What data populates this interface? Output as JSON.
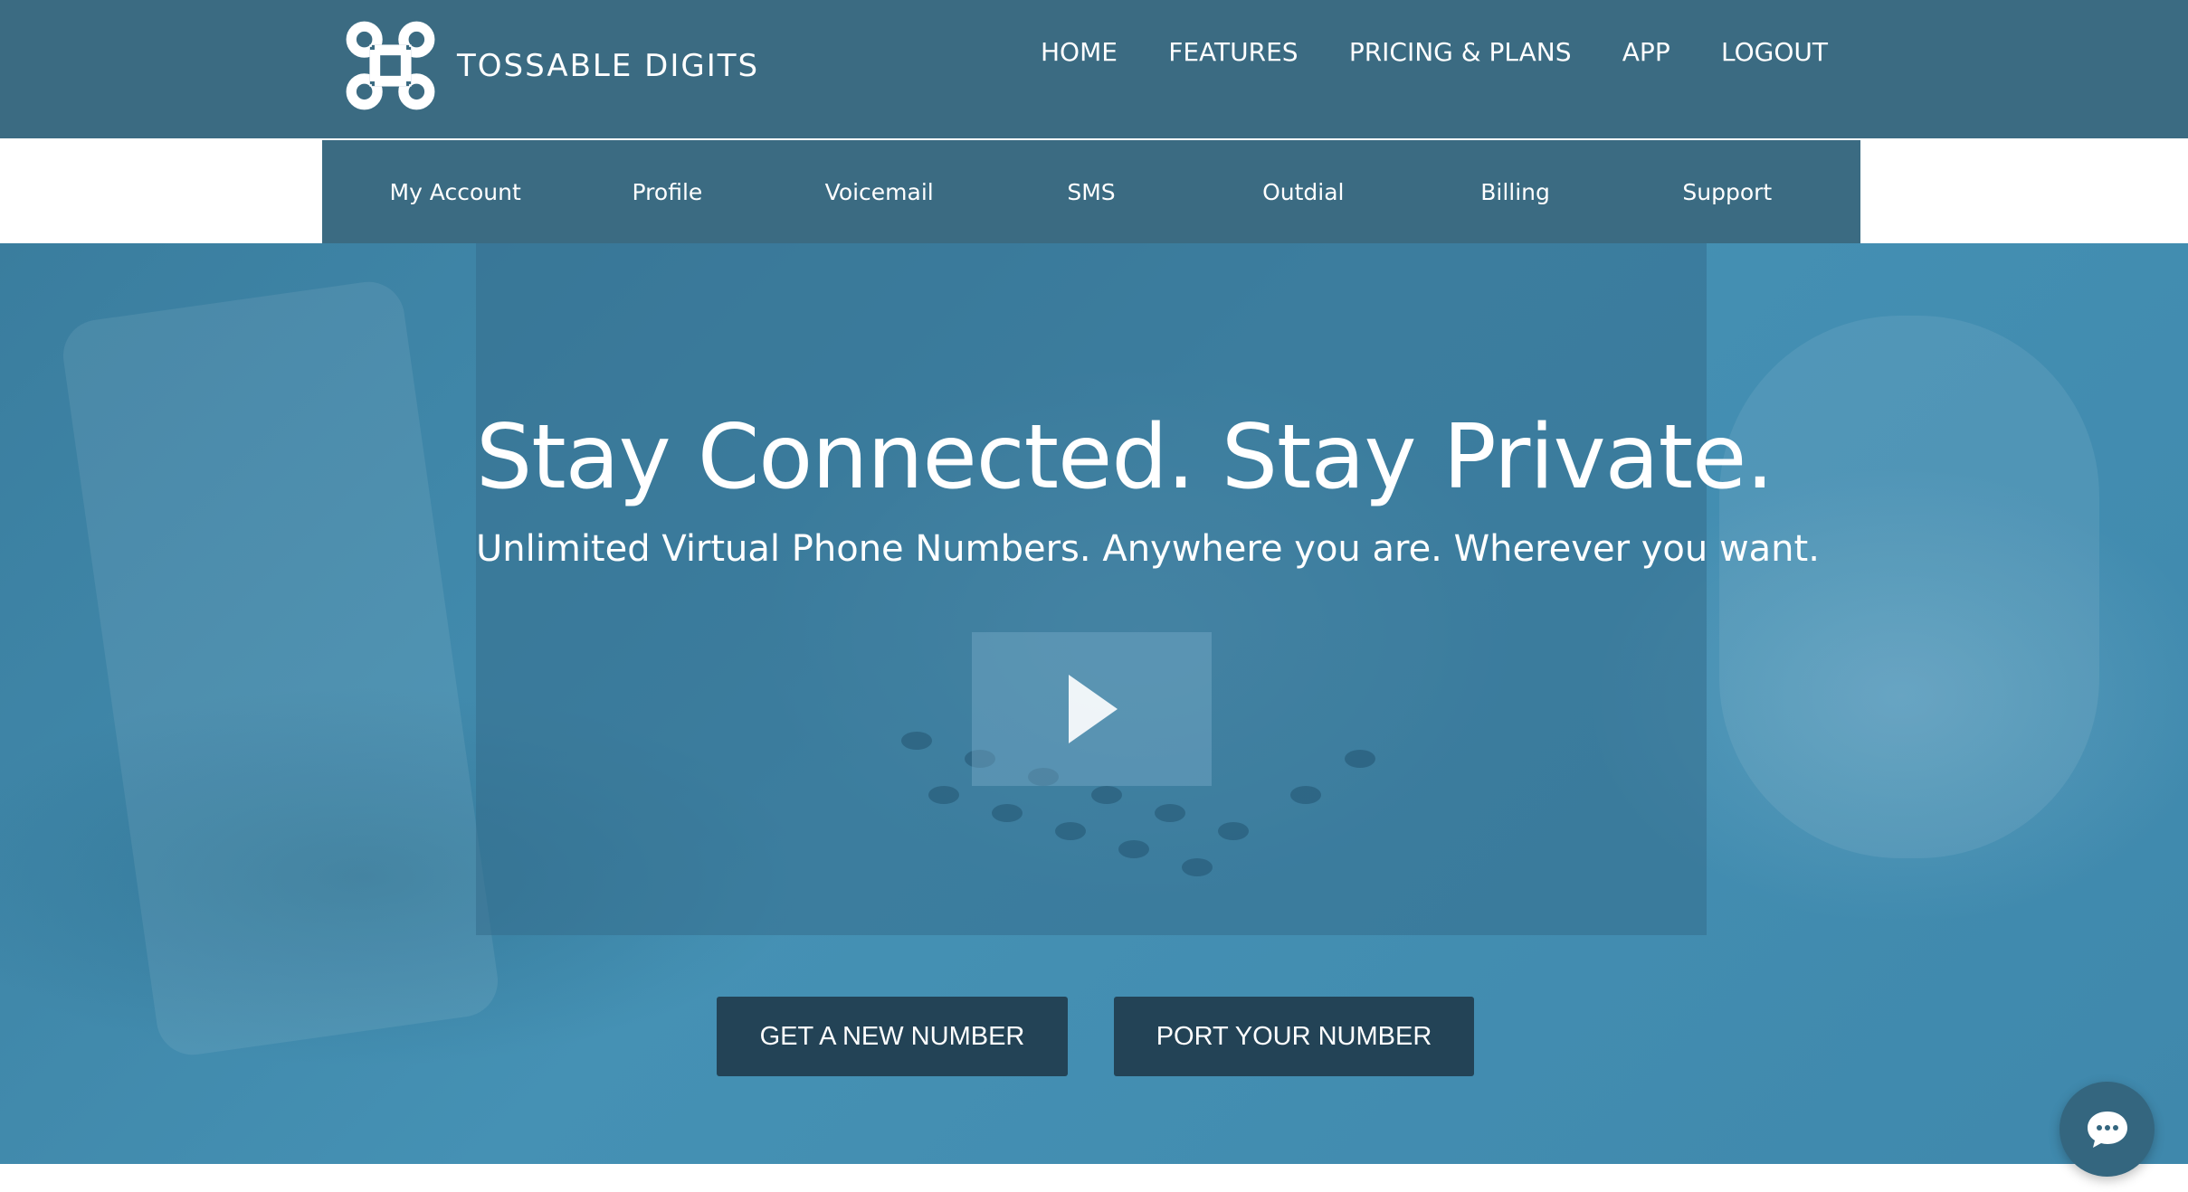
{
  "brand": {
    "name": "TOSSABLE DIGITS",
    "logo_icon": "command-key-icon"
  },
  "top_nav": {
    "items": [
      {
        "label": "HOME"
      },
      {
        "label": "FEATURES"
      },
      {
        "label": "PRICING & PLANS"
      },
      {
        "label": "APP"
      },
      {
        "label": "LOGOUT"
      }
    ]
  },
  "sub_nav": {
    "items": [
      {
        "label": "My Account"
      },
      {
        "label": "Profile"
      },
      {
        "label": "Voicemail"
      },
      {
        "label": "SMS"
      },
      {
        "label": "Outdial"
      },
      {
        "label": "Billing"
      },
      {
        "label": "Support"
      }
    ]
  },
  "hero": {
    "title": "Stay Connected. Stay Private.",
    "subtitle": "Unlimited Virtual Phone Numbers. Anywhere you are. Wherever you want.",
    "play_icon": "play-icon"
  },
  "cta": {
    "new_number_label": "GET A NEW NUMBER",
    "port_number_label": "PORT YOUR NUMBER"
  },
  "chat": {
    "icon": "chat-bubble-icon"
  },
  "colors": {
    "header_bg": "#3b6b82",
    "hero_bg": "#4591b4",
    "button_bg": "#234356"
  }
}
